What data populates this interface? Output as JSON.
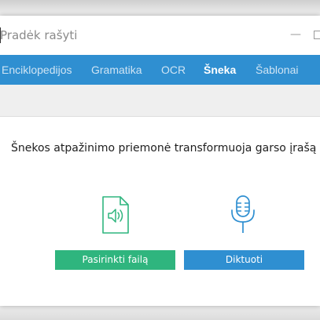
{
  "search": {
    "placeholder": "Pradėk rašyti"
  },
  "window_controls": {
    "minimize_label": "—"
  },
  "nav": {
    "tabs": [
      {
        "label": "Enciklopedijos",
        "active": false
      },
      {
        "label": "Gramatika",
        "active": false
      },
      {
        "label": "OCR",
        "active": false
      },
      {
        "label": "Šneka",
        "active": true
      },
      {
        "label": "Šablonai",
        "active": false
      }
    ]
  },
  "main": {
    "description": "Šnekos atpažinimo priemonė transformuoja garso įrašą į te",
    "file_button_label": "Pasirinkti failą",
    "dictate_button_label": "Diktuoti",
    "file_icon": "audio-file-icon",
    "mic_icon": "microphone-icon"
  },
  "colors": {
    "nav_background": "#2f8fd1",
    "file_button": "#2fb57e",
    "dictate_button": "#2f8fd1",
    "file_icon_stroke": "#2fb57e",
    "mic_icon_stroke": "#2f8fd1"
  }
}
